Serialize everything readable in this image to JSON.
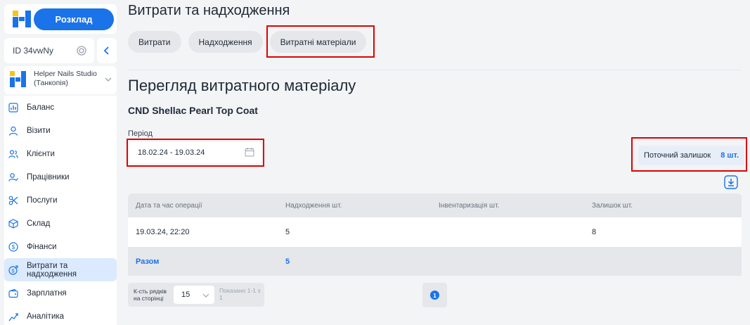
{
  "sidebar": {
    "schedule_label": "Розклад",
    "id_text": "ID 34vwNy",
    "studio_name": "Helper Nails Studio (Танкопія)",
    "items": [
      {
        "label": "Баланс",
        "icon": "chart-icon"
      },
      {
        "label": "Візити",
        "icon": "user-icon"
      },
      {
        "label": "Клієнти",
        "icon": "users-icon"
      },
      {
        "label": "Працівники",
        "icon": "user-check-icon"
      },
      {
        "label": "Послуги",
        "icon": "scissors-icon"
      },
      {
        "label": "Склад",
        "icon": "box-icon"
      },
      {
        "label": "Фінанси",
        "icon": "dollar-icon"
      },
      {
        "label": "Витрати та надходження",
        "icon": "money-flow-icon",
        "active": true
      },
      {
        "label": "Зарплатня",
        "icon": "wallet-icon"
      },
      {
        "label": "Аналітика",
        "icon": "analytics-icon"
      }
    ]
  },
  "header": {
    "title": "Витрати та надходження",
    "tabs": [
      {
        "label": "Витрати"
      },
      {
        "label": "Надходження"
      },
      {
        "label": "Витратні матеріали",
        "selected": true
      }
    ]
  },
  "main": {
    "subtitle": "Перегляд витратного матеріалу",
    "material_name": "CND Shellac Pearl Top Coat",
    "period_label": "Період",
    "period_value": "18.02.24 - 19.03.24",
    "balance_label": "Поточний залишок",
    "balance_value": "8 шт."
  },
  "table": {
    "columns": [
      "Дата та час операції",
      "Надходження шт.",
      "Інвентаризація шт.",
      "Залишок шт."
    ],
    "rows": [
      [
        "19.03.24, 22:20",
        "5",
        "",
        "8"
      ]
    ],
    "total": [
      "Разом",
      "5",
      "",
      ""
    ]
  },
  "pagination": {
    "rows_label": "К-сть рядків на сторінці",
    "rows_value": "15",
    "shown_text": "Показано 1-1 з 1",
    "current_page": "1"
  },
  "colors": {
    "accent": "#1a73e8",
    "highlight": "#e00000",
    "active_nav": "#dbeafe"
  }
}
